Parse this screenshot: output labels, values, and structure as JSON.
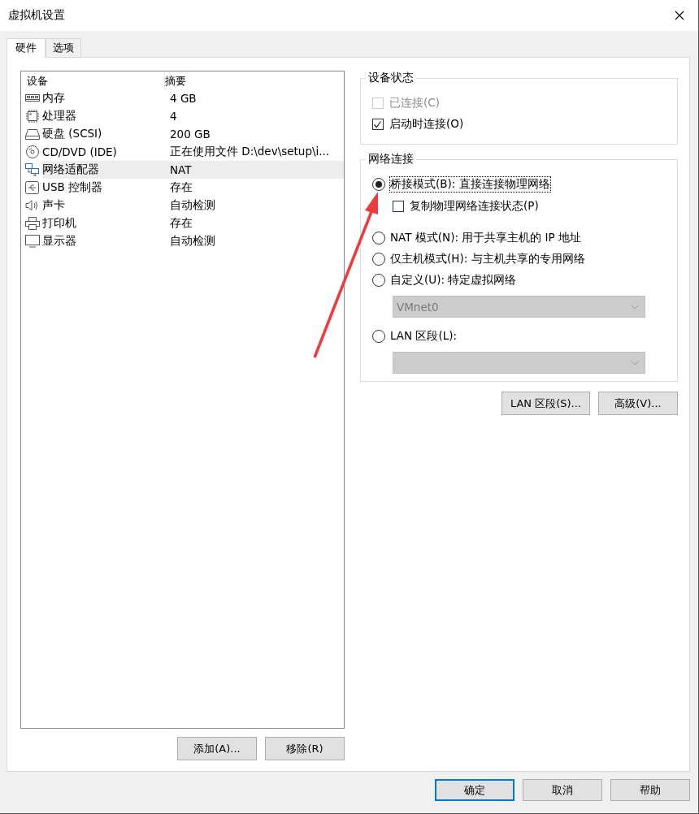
{
  "window": {
    "title": "虚拟机设置"
  },
  "tabs": [
    {
      "label": "硬件",
      "selected": true
    },
    {
      "label": "选项",
      "selected": false
    }
  ],
  "devices": {
    "columns": [
      "设备",
      "摘要"
    ],
    "rows": [
      {
        "kind": "memory",
        "name": "内存",
        "summary": "4 GB",
        "selected": false
      },
      {
        "kind": "cpu",
        "name": "处理器",
        "summary": "4",
        "selected": false
      },
      {
        "kind": "disk",
        "name": "硬盘 (SCSI)",
        "summary": "200 GB",
        "selected": false
      },
      {
        "kind": "cd",
        "name": "CD/DVD (IDE)",
        "summary": "正在使用文件 D:\\dev\\setup\\i...",
        "selected": false
      },
      {
        "kind": "network",
        "name": "网络适配器",
        "summary": "NAT",
        "selected": true
      },
      {
        "kind": "usb",
        "name": "USB 控制器",
        "summary": "存在",
        "selected": false
      },
      {
        "kind": "sound",
        "name": "声卡",
        "summary": "自动检测",
        "selected": false
      },
      {
        "kind": "printer",
        "name": "打印机",
        "summary": "存在",
        "selected": false
      },
      {
        "kind": "display",
        "name": "显示器",
        "summary": "自动检测",
        "selected": false
      }
    ],
    "buttons": [
      "添加(A)...",
      "移除(R)"
    ]
  },
  "device_status": {
    "title": "设备状态",
    "options": [
      {
        "label": "已连接(C)",
        "checked": false,
        "disabled": true
      },
      {
        "label": "启动时连接(O)",
        "checked": true,
        "disabled": false
      }
    ]
  },
  "network": {
    "title": "网络连接",
    "options": [
      {
        "kind": "radio",
        "label": "桥接模式(B): 直接连接物理网络",
        "selected": true,
        "focused": true
      },
      {
        "kind": "checkbox",
        "label": "复制物理网络连接状态(P)",
        "checked": false
      },
      {
        "kind": "radio",
        "label": "NAT 模式(N): 用于共享主机的 IP 地址",
        "selected": false,
        "focused": false
      },
      {
        "kind": "radio",
        "label": "仅主机模式(H): 与主机共享的专用网络",
        "selected": false,
        "focused": false
      },
      {
        "kind": "radio",
        "label": "自定义(U): 特定虚拟网络",
        "selected": false,
        "focused": false
      },
      {
        "kind": "select",
        "value": "VMnet0",
        "disabled": true
      },
      {
        "kind": "radio",
        "label": "LAN 区段(L):",
        "selected": false,
        "focused": false
      },
      {
        "kind": "select",
        "disabled": true
      }
    ],
    "buttons": [
      "LAN 区段(S)...",
      "高级(V)..."
    ]
  },
  "footer_buttons": [
    {
      "label": "确定",
      "default": true
    },
    {
      "label": "取消",
      "default": false
    },
    {
      "label": "帮助",
      "default": false
    }
  ]
}
